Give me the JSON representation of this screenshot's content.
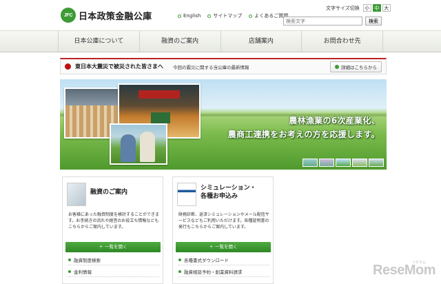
{
  "header": {
    "logo_mark": "JFC",
    "logo_text": "日本政策金融公庫",
    "util_links": [
      "English",
      "サイトマップ",
      "よくあるご質問"
    ],
    "font_size_label": "文字サイズ切換",
    "font_sizes": [
      "小",
      "中",
      "大"
    ],
    "search_placeholder": "検索文字",
    "search_button": "検索"
  },
  "nav": {
    "items": [
      "日本公庫について",
      "融資のご案内",
      "店舗案内",
      "お問合わせ先"
    ]
  },
  "notice": {
    "title": "東日本大震災で被災された皆さまへ",
    "subtitle": "今回の震災に関する当公庫の最新情報",
    "more": "詳細はこちらから"
  },
  "hero": {
    "line1": "農林漁業の6次産業化、",
    "line2": "農商工連携をお考えの方を応援します。"
  },
  "cards": [
    {
      "title": "融資のご案内",
      "desc": "お客様にあった融資制度を検討することができます。お手続きの流れや経営のお役立ち情報などもこちらからご案内しています。",
      "button": "一覧を開く",
      "links": [
        "融資制度検索",
        "金利情報"
      ]
    },
    {
      "title_line1": "シミュレーション・",
      "title_line2": "各種お申込み",
      "desc": "財務診断、返済シミュレーションやメール配信サービスなどもご利用いただけます。各種証明書の発行もこちらからご案内しています。",
      "button": "一覧を開く",
      "links": [
        "各種書式ダウンロード",
        "融資相談予約・創業資料請求"
      ]
    }
  ],
  "watermark": {
    "brand": "ReseMom",
    "kana": "リセマム"
  }
}
